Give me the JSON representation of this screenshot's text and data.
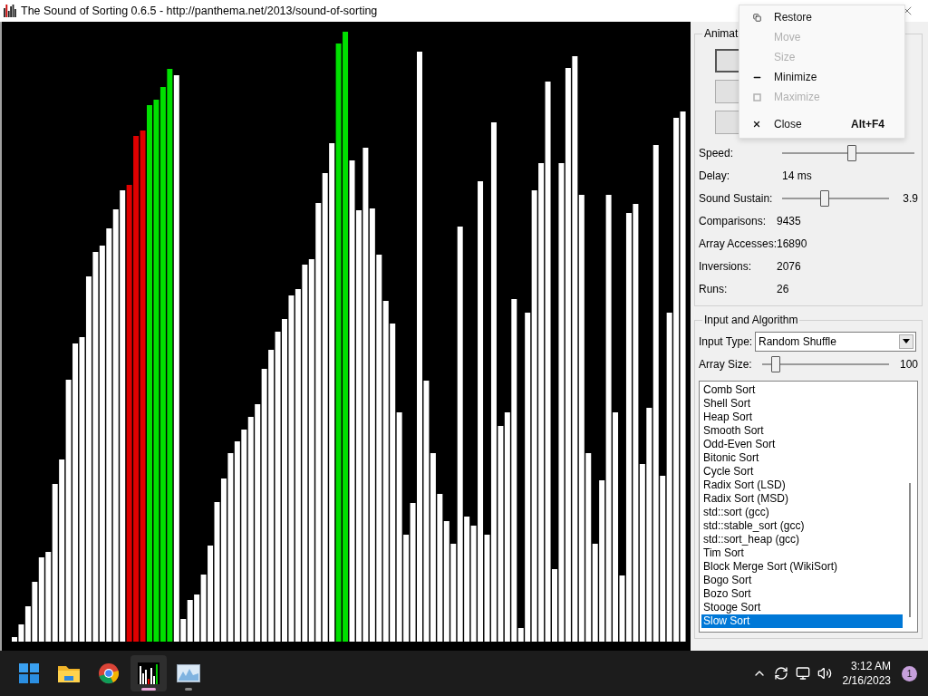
{
  "window": {
    "title": "The Sound of Sorting 0.6.5 - http://panthema.net/2013/sound-of-sorting"
  },
  "context_menu": {
    "items": [
      {
        "kind": "restore",
        "label": "Restore",
        "disabled": false
      },
      {
        "kind": "none",
        "label": "Move",
        "disabled": true
      },
      {
        "kind": "none",
        "label": "Size",
        "disabled": true
      },
      {
        "kind": "minimize",
        "label": "Minimize",
        "disabled": false
      },
      {
        "kind": "maximize",
        "label": "Maximize",
        "disabled": true
      },
      {
        "kind": "close",
        "label": "Close",
        "disabled": false,
        "shortcut": "Alt+F4"
      }
    ]
  },
  "animation_controls": {
    "title": "Animat",
    "speed": {
      "label": "Speed:",
      "level": 0.53
    },
    "delay": {
      "label": "Delay:",
      "value": "14 ms"
    },
    "sound_sustain": {
      "label": "Sound Sustain:",
      "level": 0.39,
      "reading": "3.9"
    },
    "stats": [
      {
        "label": "Comparisons:",
        "value": "9435"
      },
      {
        "label": "Array Accesses:",
        "value": "16890"
      },
      {
        "label": "Inversions:",
        "value": "2076"
      },
      {
        "label": "Runs:",
        "value": "26"
      }
    ]
  },
  "input_and_algorithm": {
    "title": "Input and Algorithm",
    "input_type": {
      "label": "Input Type:",
      "value": "Random Shuffle"
    },
    "array_size": {
      "label": "Array Size:",
      "level": 0.08,
      "reading": "100"
    },
    "algorithms": [
      {
        "label": "Comb Sort",
        "selected": false
      },
      {
        "label": "Shell Sort",
        "selected": false
      },
      {
        "label": "Heap Sort",
        "selected": false
      },
      {
        "label": "Smooth Sort",
        "selected": false
      },
      {
        "label": "Odd-Even Sort",
        "selected": false
      },
      {
        "label": "Bitonic Sort",
        "selected": false
      },
      {
        "label": "Cycle Sort",
        "selected": false
      },
      {
        "label": "Radix Sort (LSD)",
        "selected": false
      },
      {
        "label": "Radix Sort (MSD)",
        "selected": false
      },
      {
        "label": "std::sort (gcc)",
        "selected": false
      },
      {
        "label": "std::stable_sort (gcc)",
        "selected": false
      },
      {
        "label": "std::sort_heap (gcc)",
        "selected": false
      },
      {
        "label": "Tim Sort",
        "selected": false
      },
      {
        "label": "Block Merge Sort (WikiSort)",
        "selected": false
      },
      {
        "label": "Bogo Sort",
        "selected": false
      },
      {
        "label": "Bozo Sort",
        "selected": false
      },
      {
        "label": "Stooge Sort",
        "selected": false
      },
      {
        "label": "Slow Sort",
        "selected": true
      }
    ]
  },
  "taskbar": {
    "apps": [
      {
        "kind": "start",
        "selected": false
      },
      {
        "kind": "folder",
        "selected": false
      },
      {
        "kind": "browser",
        "selected": false
      },
      {
        "kind": "sorting",
        "selected": true
      },
      {
        "kind": "monitor",
        "selected": false
      }
    ],
    "time": "3:12 AM",
    "date": "2/16/2023",
    "notification_count": "1"
  }
}
